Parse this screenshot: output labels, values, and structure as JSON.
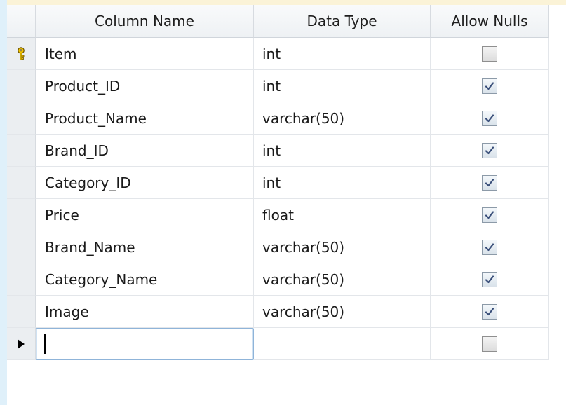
{
  "colors": {
    "left_strip": "#dff0fa",
    "top_strip": "#fbf3d7",
    "header_bg": "#eef1f4",
    "grid_line": "#e3e6ea",
    "selected_border": "#8fb4d9"
  },
  "grid": {
    "headers": {
      "column_name": "Column Name",
      "data_type": "Data Type",
      "allow_nulls": "Allow Nulls"
    },
    "rows": [
      {
        "name": "Item",
        "type": "int",
        "allow_nulls": false,
        "primary_key": true
      },
      {
        "name": "Product_ID",
        "type": "int",
        "allow_nulls": true,
        "primary_key": false
      },
      {
        "name": "Product_Name",
        "type": "varchar(50)",
        "allow_nulls": true,
        "primary_key": false
      },
      {
        "name": "Brand_ID",
        "type": "int",
        "allow_nulls": true,
        "primary_key": false
      },
      {
        "name": "Category_ID",
        "type": "int",
        "allow_nulls": true,
        "primary_key": false
      },
      {
        "name": "Price",
        "type": "float",
        "allow_nulls": true,
        "primary_key": false
      },
      {
        "name": "Brand_Name",
        "type": "varchar(50)",
        "allow_nulls": true,
        "primary_key": false
      },
      {
        "name": "Category_Name",
        "type": "varchar(50)",
        "allow_nulls": true,
        "primary_key": false
      },
      {
        "name": "Image",
        "type": "varchar(50)",
        "allow_nulls": true,
        "primary_key": false
      }
    ],
    "new_row": {
      "name": "",
      "type": "",
      "allow_nulls": false
    },
    "icons": {
      "primary_key": "key-icon",
      "current_row": "arrow-right-icon",
      "checked": "checkmark-icon"
    }
  }
}
